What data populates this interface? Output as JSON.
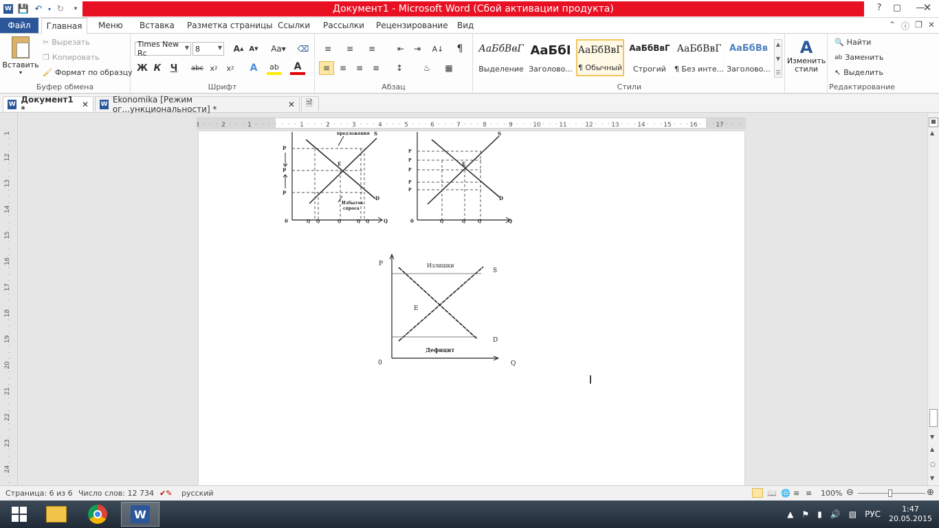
{
  "window": {
    "title": "Документ1  -  Microsoft Word (Сбой активации продукта)"
  },
  "ribbon_tabs": {
    "file": "Файл",
    "items": [
      "Главная",
      "Меню",
      "Вставка",
      "Разметка страницы",
      "Ссылки",
      "Рассылки",
      "Рецензирование",
      "Вид"
    ]
  },
  "clipboard": {
    "paste": "Вставить",
    "cut": "Вырезать",
    "copy": "Копировать",
    "format_painter": "Формат по образцу",
    "label": "Буфер обмена"
  },
  "font": {
    "name": "Times New Rc",
    "size": "8",
    "label": "Шрифт",
    "bold": "Ж",
    "italic": "К",
    "underline": "Ч",
    "strike": "abc",
    "aa": "Aa"
  },
  "paragraph": {
    "label": "Абзац"
  },
  "styles": {
    "label": "Стили",
    "items": [
      {
        "preview": "АаБбВвГ",
        "name": "Выделение"
      },
      {
        "preview": "АаБбІ",
        "name": "Заголово..."
      },
      {
        "preview": "АаБбВвГ",
        "name": "¶ Обычный"
      },
      {
        "preview": "АаБбВвГ",
        "name": "Строгий"
      },
      {
        "preview": "АаБбВвГ",
        "name": "¶ Без инте..."
      },
      {
        "preview": "АаБбВв",
        "name": "Заголово..."
      }
    ],
    "change": "Изменить стили"
  },
  "editing": {
    "label": "Редактирование",
    "find": "Найти",
    "replace": "Заменить",
    "select": "Выделить"
  },
  "doc_tabs": [
    {
      "title": "Документ1  *"
    },
    {
      "title": "Ekonomika [Режим ог...ункциональности]  *"
    }
  ],
  "ruler": {
    "h_ticks": [
      "3",
      "2",
      "1",
      "1",
      "2",
      "3",
      "4",
      "5",
      "6",
      "7",
      "8",
      "9",
      "10",
      "11",
      "12",
      "13",
      "14",
      "15",
      "16",
      "17"
    ],
    "v_ticks": [
      "11",
      "12",
      "13",
      "14",
      "15",
      "16",
      "17",
      "18",
      "19",
      "20",
      "21",
      "22",
      "23",
      "24"
    ]
  },
  "figures": {
    "fig1": {
      "labels": {
        "top": "предложения",
        "S": "S",
        "D": "D",
        "E": "E",
        "o": "0",
        "Q": "Q",
        "excess": "Избыток",
        "demand": "спроса",
        "P1": "P",
        "Pe": "P",
        "P2": "P",
        "qA": "Q",
        "qB": "Q",
        "qE": "Q",
        "qC": "Q",
        "qD": "Q"
      }
    },
    "fig2": {
      "labels": {
        "S": "S",
        "D": "D",
        "E": "E",
        "o": "0",
        "Q": "Q",
        "P1": "P",
        "P2": "P",
        "Pe": "P",
        "P3": "P",
        "P4": "P",
        "q1": "Q",
        "qE": "Q",
        "q2": "Q"
      }
    },
    "fig3": {
      "labels": {
        "P": "P",
        "S": "S",
        "D": "D",
        "E": "E",
        "o": "0",
        "Q": "Q",
        "surplus": "Излишки",
        "deficit": "Дефицит"
      }
    }
  },
  "status": {
    "page": "Страница: 6 из 6",
    "words": "Число слов: 12 734",
    "lang": "русский",
    "zoom": "100%"
  },
  "tray": {
    "lang": "РУС",
    "time": "1:47",
    "date": "20.05.2015"
  },
  "colors": {
    "word_blue": "#2b579a",
    "title_red": "#e81123"
  }
}
